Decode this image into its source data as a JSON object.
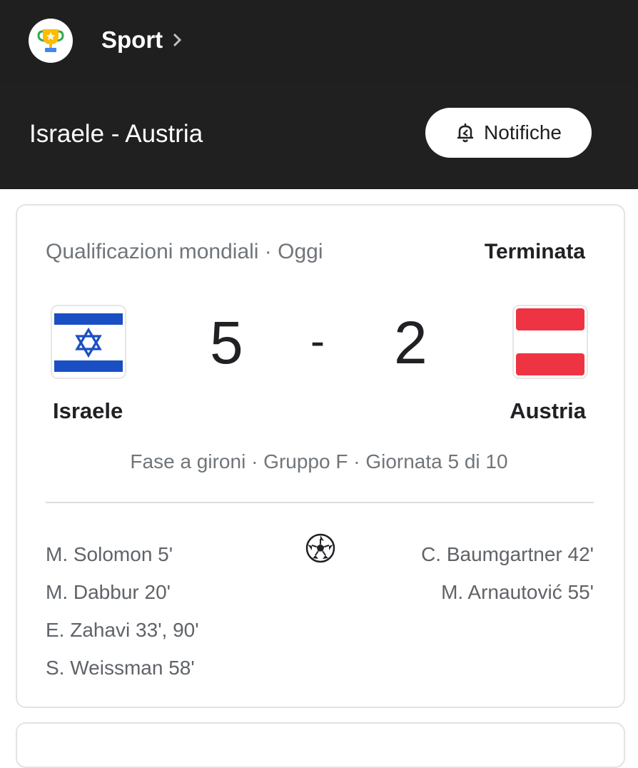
{
  "topbar": {
    "section_label": "Sport",
    "logo_icon": "trophy-icon",
    "chevron_icon": "chevron-right-icon"
  },
  "header": {
    "title": "Israele - Austria",
    "notify_label": "Notifiche",
    "notify_icon": "bell-icon"
  },
  "match": {
    "competition": "Qualificazioni mondiali · Oggi",
    "status": "Terminata",
    "home": {
      "name": "Israele",
      "score": "5",
      "flag_icon": "israel-flag-icon"
    },
    "score_separator": "-",
    "away": {
      "name": "Austria",
      "score": "2",
      "flag_icon": "austria-flag-icon"
    },
    "round": "Fase a gironi · Gruppo F · Giornata 5 di 10",
    "goal_icon": "soccer-ball-icon",
    "home_scorers": [
      "M. Solomon 5'",
      "M. Dabbur 20'",
      "E. Zahavi 33', 90'",
      "S. Weissman 58'"
    ],
    "away_scorers": [
      "C. Baumgartner 42'",
      "M. Arnautović 55'"
    ]
  },
  "colors": {
    "topbar_bg": "#1f1f1f",
    "header_bg": "#202020",
    "israel_blue": "#1a4fc4",
    "austria_red": "#ee3342",
    "muted_text": "#70757a"
  }
}
